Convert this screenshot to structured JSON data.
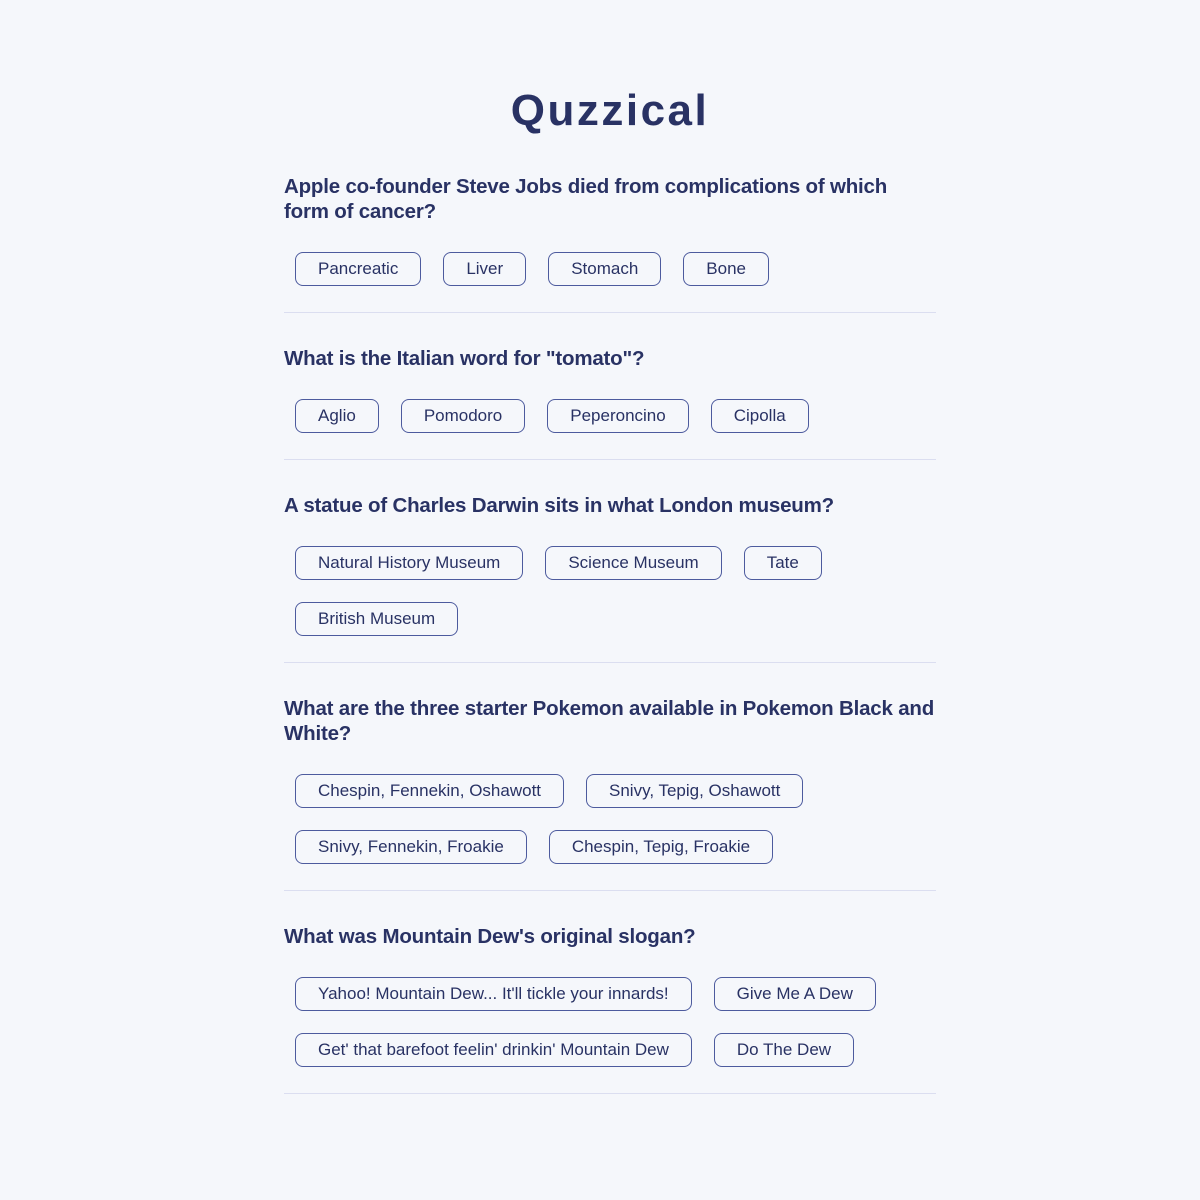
{
  "app": {
    "title": "Quzzical"
  },
  "questions": [
    {
      "text": "Apple co-founder Steve Jobs died from complications of which form of cancer?",
      "answers": [
        "Pancreatic",
        "Liver",
        "Stomach",
        "Bone"
      ]
    },
    {
      "text": "What is the Italian word for \"tomato\"?",
      "answers": [
        "Aglio",
        "Pomodoro",
        "Peperoncino",
        "Cipolla"
      ]
    },
    {
      "text": "A statue of Charles Darwin sits in what London museum?",
      "answers": [
        "Natural History Museum",
        "Science Museum",
        "Tate",
        "British Museum"
      ]
    },
    {
      "text": "What are the three starter Pokemon available in Pokemon Black and White?",
      "answers": [
        "Chespin, Fennekin, Oshawott",
        "Snivy, Tepig, Oshawott",
        "Snivy, Fennekin, Froakie",
        "Chespin, Tepig, Froakie"
      ]
    },
    {
      "text": "What was Mountain Dew's original slogan?",
      "answers": [
        "Yahoo! Mountain Dew... It'll tickle your innards!",
        "Give Me A Dew",
        "Get' that barefoot feelin' drinkin' Mountain Dew",
        "Do The Dew"
      ]
    }
  ],
  "colors": {
    "background": "#F5F7FB",
    "text": "#293264",
    "answer_border": "#4D5B9E",
    "divider": "#DBDEF0"
  }
}
